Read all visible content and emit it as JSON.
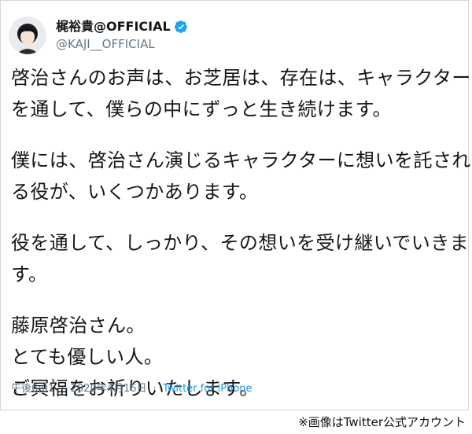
{
  "tweet": {
    "display_name": "梶裕貴@OFFICIAL",
    "handle": "@KAJI__OFFICIAL",
    "verified": true,
    "paragraphs": [
      [
        "啓治さんのお声は、お芝居は、存在は、キャラクター",
        "を通して、僕らの中にずっと生き続けます。"
      ],
      [
        "僕には、啓治さん演じるキャラクターに想いを託され",
        "る役が、いくつかあります。"
      ],
      [
        "役を通して、しっかり、その想いを受け継いでいきま",
        "す。"
      ],
      [
        "藤原啓治さん。",
        "とても優しい人。",
        "ご冥福をお祈りいたします。"
      ]
    ],
    "time": "午後6:01",
    "separator": "·",
    "date": "2020年4月16日",
    "source": "Twitter for iPhone"
  },
  "caption": "※画像はTwitter公式アカウント",
  "colors": {
    "text": "#14171a",
    "muted": "#657786",
    "link": "#1b95e0",
    "verified": "#1da1f2"
  },
  "icons": {
    "verified": "verified-badge-icon",
    "avatar": "profile-avatar"
  }
}
